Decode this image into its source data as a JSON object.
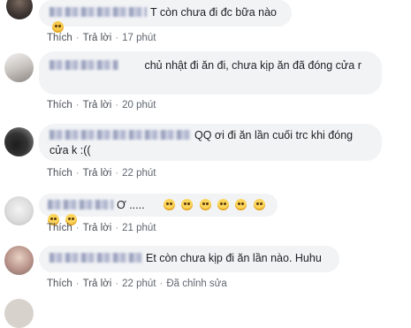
{
  "comments": [
    {
      "text": "T còn chưa đi đc bữa nào",
      "emoji": "slightly-frowning-face",
      "actions": {
        "like": "Thích",
        "reply": "Trả lời",
        "time": "17 phút"
      }
    },
    {
      "text": "chủ nhật đi ăn đi, chưa kịp ăn đã đóng cửa r",
      "actions": {
        "like": "Thích",
        "reply": "Trả lời",
        "time": "20 phút"
      }
    },
    {
      "text": "QQ ơi đi ăn lần cuối trc khi đóng cửa k :((",
      "actions": {
        "like": "Thích",
        "reply": "Trả lời",
        "time": "22 phút"
      }
    },
    {
      "text": "Ơ .....",
      "emoji": "pleading-face",
      "emoji_count": 8,
      "actions": {
        "like": "Thích",
        "reply": "Trả lời",
        "time": "21 phút"
      }
    },
    {
      "text": "Et còn chưa kịp đi ăn lần nào. Huhu",
      "actions": {
        "like": "Thích",
        "reply": "Trả lời",
        "time": "22 phút",
        "edited": "Đã chỉnh sửa"
      }
    }
  ]
}
